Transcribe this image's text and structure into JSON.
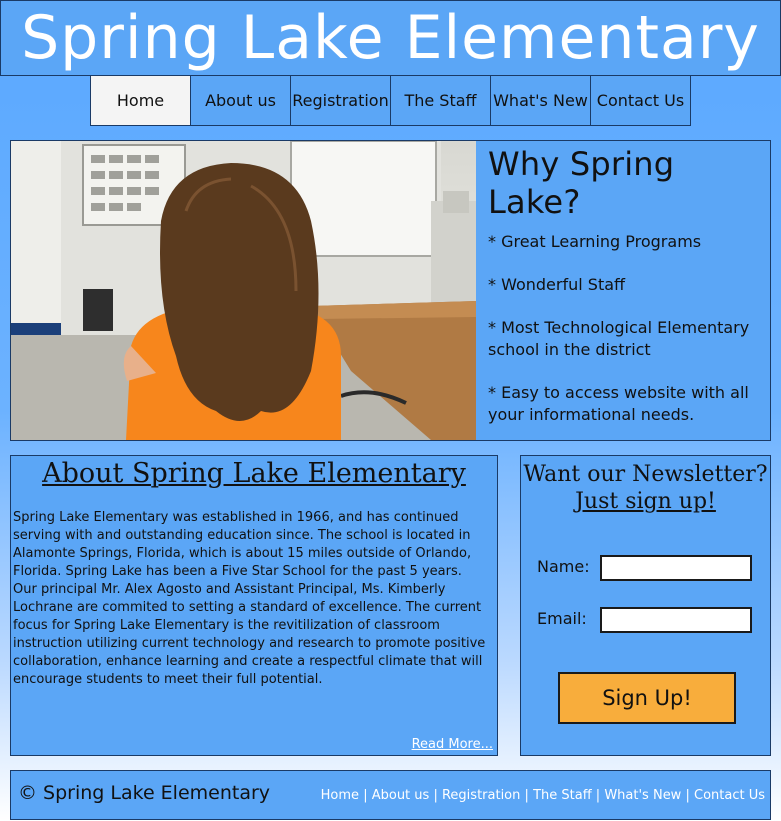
{
  "header": {
    "title": "Spring Lake Elementary"
  },
  "nav": {
    "items": [
      {
        "label": "Home",
        "active": true
      },
      {
        "label": "About us",
        "active": false
      },
      {
        "label": "Registration",
        "active": false
      },
      {
        "label": "The Staff",
        "active": false
      },
      {
        "label": "What's New",
        "active": false
      },
      {
        "label": "Contact Us",
        "active": false
      }
    ]
  },
  "feature": {
    "photo_icon": "classroom-photo",
    "why_title": "Why Spring Lake?",
    "points": [
      "* Great Learning Programs",
      "* Wonderful Staff",
      "* Most Technological Elementary school in the district",
      "* Easy to access website with all your informational needs."
    ]
  },
  "about": {
    "title": "About Spring Lake Elementary",
    "body": "Spring Lake Elementary was established in 1966, and has continued serving with and outstanding education since. The school is located in Alamonte Springs, Florida, which is about 15 miles outside of Orlando, Florida. Spring Lake has been a Five Star School for the past 5 years. Our principal Mr. Alex Agosto and Assistant Principal, Ms. Kimberly Lochrane are commited to setting a standard of excellence. The current focus for Spring Lake Elementary is the revitilization of classroom instruction utilizing current technology and research to promote positive collaboration, enhance learning and create a respectful climate that will encourage students to meet their full potential.",
    "read_more": "Read More..."
  },
  "newsletter": {
    "title": "Want our Newsletter?",
    "subtitle": "Just sign up!",
    "name_label": "Name:",
    "email_label": "Email:",
    "name_value": "",
    "email_value": "",
    "button_label": "Sign Up!"
  },
  "footer": {
    "copyright": "© Spring Lake Elementary",
    "links": [
      "Home",
      "About us",
      "Registration",
      "The Staff",
      "What's New",
      "Contact Us"
    ],
    "separator": "|"
  },
  "colors": {
    "panel": "#5ba6f6",
    "border": "#1a3a66",
    "button": "#f8ad3c",
    "shirt": "#f7861c",
    "hair": "#5a3a1e"
  }
}
